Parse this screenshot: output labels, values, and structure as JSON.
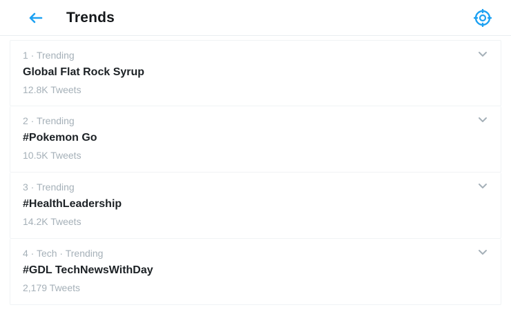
{
  "header": {
    "title": "Trends",
    "back_icon": "back-arrow-icon",
    "settings_icon": "gear-icon"
  },
  "colors": {
    "accent": "#1da1f2",
    "muted_text": "#a5b0b8",
    "primary_text": "#14171a"
  },
  "trends": [
    {
      "meta": "1 · Trending",
      "name": "Global Flat Rock Syrup",
      "count": "12.8K Tweets"
    },
    {
      "meta": "2 · Trending",
      "name": "#Pokemon Go",
      "count": "10.5K Tweets"
    },
    {
      "meta": "3 · Trending",
      "name": "#HealthLeadership",
      "count": "14.2K Tweets"
    },
    {
      "meta": "4 · Tech · Trending",
      "name": "#GDL TechNewsWithDay",
      "count": "2,179 Tweets"
    }
  ]
}
